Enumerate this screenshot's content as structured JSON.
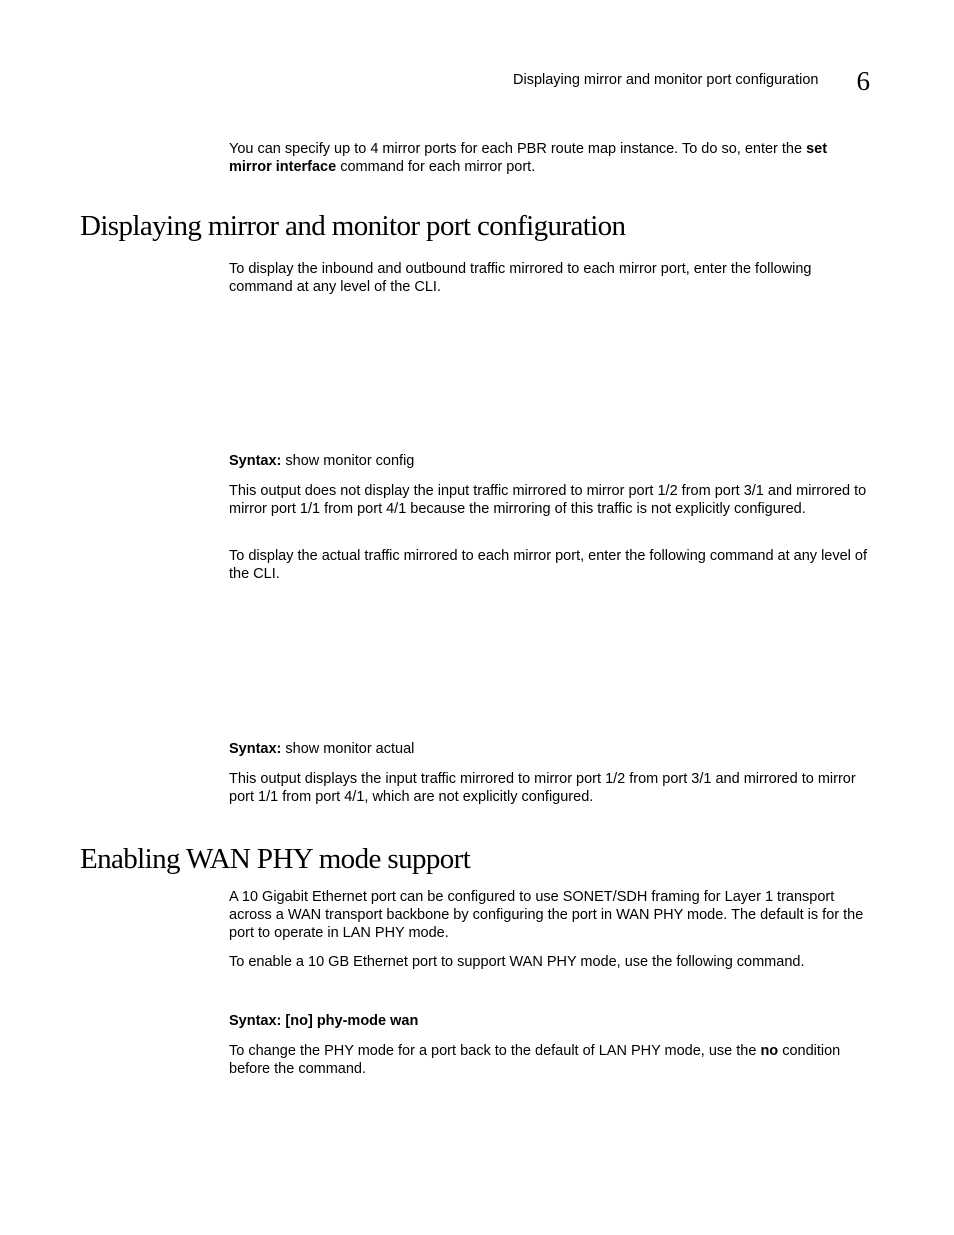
{
  "header": {
    "title": "Displaying mirror and monitor port configuration",
    "chapter": "6"
  },
  "intro": {
    "before_bold": "You can specify up to 4 mirror ports for each PBR route map instance.  To do so, enter the ",
    "bold": "set mirror interface",
    "after_bold": " command for each mirror port."
  },
  "section1": {
    "title": "Displaying mirror and monitor port configuration",
    "p1": "To display the inbound and outbound traffic mirrored to each mirror port, enter the following command at any level of the CLI.",
    "syntax_label": "Syntax:",
    "syntax1_cmd": " show monitor config",
    "p2": "This output does not display the input traffic mirrored to mirror port 1/2 from port 3/1 and mirrored to mirror port 1/1 from port 4/1 because the mirroring of this traffic is not explicitly configured.",
    "p3": "To display the actual traffic mirrored to each mirror port, enter the following command at any level of the CLI.",
    "syntax2_cmd": " show monitor actual",
    "p4": "This output displays the input traffic mirrored to mirror port 1/2 from port 3/1 and mirrored to mirror port 1/1 from port 4/1, which are not explicitly configured."
  },
  "section2": {
    "title": "Enabling WAN PHY mode support",
    "p5": "A 10 Gigabit Ethernet port can be configured to use SONET/SDH framing for Layer 1 transport across a WAN transport backbone by configuring the port in WAN PHY mode. The default is for the port to operate in LAN PHY mode.",
    "p6": "To enable a 10 GB Ethernet port to support WAN PHY mode, use the following command.",
    "syntax_label": "Syntax:",
    "syntax3_cmd": " [no] phy-mode wan",
    "p7_a": "To change the PHY mode for a port back to the default of LAN PHY mode, use the ",
    "p7_bold": "no",
    "p7_b": " condition before the command."
  }
}
